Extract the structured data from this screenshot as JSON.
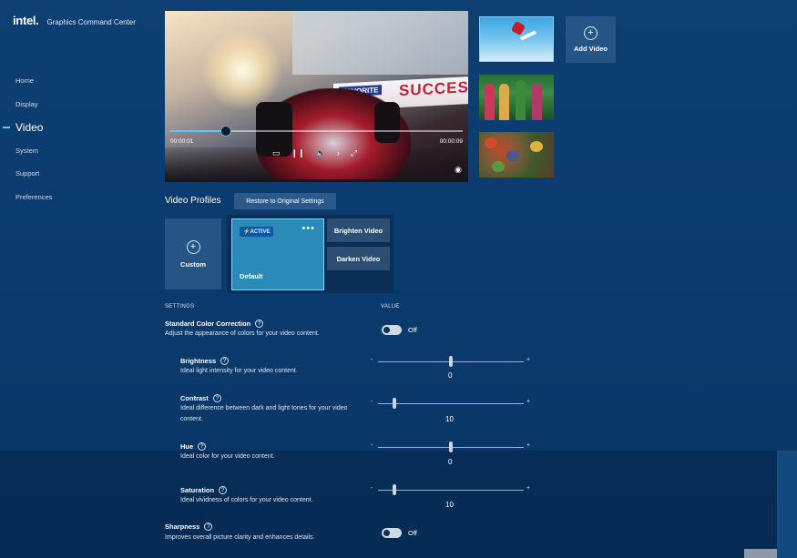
{
  "app": {
    "logo": "intel.",
    "title": "Graphics Command Center"
  },
  "nav": {
    "items": [
      {
        "label": "Home"
      },
      {
        "label": "Display"
      },
      {
        "label": "Video",
        "active": true
      },
      {
        "label": "System"
      },
      {
        "label": "Support"
      },
      {
        "label": "Preferences"
      }
    ]
  },
  "player": {
    "banner_favorite": "FAVORITE",
    "banner_text": "SUCCES",
    "time_current": "00:00:01",
    "time_total": "00:00:09",
    "progress": 0.19,
    "controls": [
      "▭",
      "❙❙",
      "🔈",
      "›",
      "⤢"
    ],
    "eye_icon": "◉"
  },
  "thumbnails": {
    "add_video_label": "Add Video",
    "plus": "+"
  },
  "profiles": {
    "title": "Video Profiles",
    "restore_label": "Restore to Original Settings",
    "custom_label": "Custom",
    "plus": "+",
    "default_label": "Default",
    "active_badge": "⚡ACTIVE",
    "more": "•••",
    "brighten_label": "Brighten Video",
    "darken_label": "Darken Video"
  },
  "settings": {
    "header_settings": "SETTINGS",
    "header_value": "VALUE",
    "help_glyph": "?",
    "minus": "-",
    "plus": "+",
    "standard_color": {
      "title": "Standard Color Correction",
      "desc": "Adjust the appearance of colors for your video content.",
      "state": "Off"
    },
    "brightness": {
      "title": "Brightness",
      "desc": "Ideal light intensity for your video content.",
      "value": "0",
      "level": 0.5
    },
    "contrast": {
      "title": "Contrast",
      "desc": "Ideal difference between dark and light tones for your video content.",
      "value": "10",
      "level": 0.11
    },
    "hue": {
      "title": "Hue",
      "desc": "Ideal color for your video content.",
      "value": "0",
      "level": 0.5
    },
    "saturation": {
      "title": "Saturation",
      "desc": "Ideal vividness of colors for your video content.",
      "value": "10",
      "level": 0.11
    },
    "sharpness": {
      "title": "Sharpness",
      "desc": "Improves overall picture clarity and enhances details.",
      "state": "Off"
    }
  },
  "colors": {
    "accent": "#5cc6ff",
    "background": "#0d3f73",
    "active_card": "#2a8bb8"
  }
}
